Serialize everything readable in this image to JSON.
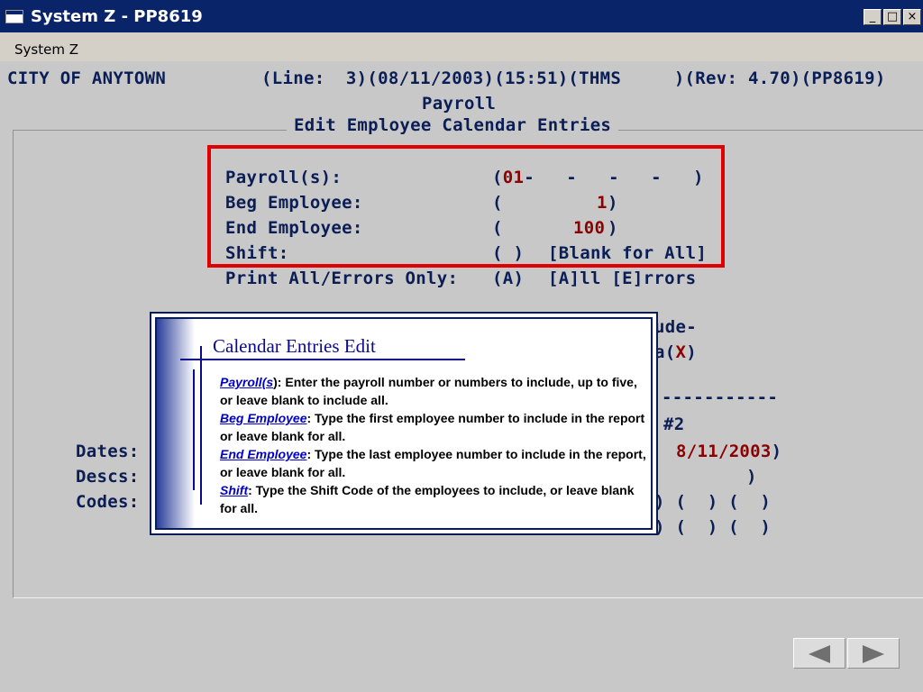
{
  "window": {
    "title": "System Z - PP8619",
    "minimize": "_",
    "maximize": "□",
    "close": "×"
  },
  "menu": {
    "system": "System Z"
  },
  "header": {
    "org": "CITY OF ANYTOWN",
    "status": "(Line:  3)(08/11/2003)(15:51)(THMS     )(Rev: 4.70)(PP8619)",
    "module": "Payroll",
    "section": "Edit Employee Calendar Entries"
  },
  "fields": {
    "payrolls": {
      "label": "Payroll(s):",
      "open": "(",
      "value": "01",
      "rest": "-   -   -   -   )"
    },
    "beg": {
      "label": "Beg Employee:",
      "open": "(",
      "value": "1",
      "close": ")"
    },
    "end": {
      "label": "End Employee:",
      "open": "(",
      "value": "100",
      "close": ")"
    },
    "shift": {
      "label": "Shift:",
      "value": "( )",
      "hint": "[Blank for All]"
    },
    "print": {
      "label": "Print All/Errors Only:",
      "value": "(A)",
      "hint": "[A]ll [E]rrors"
    }
  },
  "background_fragments": {
    "ude": "ude-",
    "a_open": "a(",
    "x": "X",
    "close_paren": ")",
    "dashes": "-----------",
    "num2": "#2",
    "date2": "8/11/2003",
    "desc_close": ")",
    "codes_row1": ") (  ) (  )",
    "codes_row2": ") (  ) (  )",
    "row_left": "(   ) (   ) (   ) (   )"
  },
  "row_labels": {
    "dates": "Dates:",
    "descs": "Descs:",
    "codes": "Codes:"
  },
  "help": {
    "title": "Calendar Entries Edit",
    "items": [
      {
        "term": "Payroll(s",
        "tail": "):  Enter the payroll number or numbers to include, up to five, or leave blank to include all."
      },
      {
        "term": "Beg Employee",
        "tail": ":  Type the first employee number to include in the report or leave blank for all."
      },
      {
        "term": "End Employee",
        "tail": ":  Type the last employee number to include in the report, or leave blank for all."
      },
      {
        "term": "Shift",
        "tail": ":  Type the Shift Code  of the employees to include, or leave blank for all."
      }
    ]
  },
  "nav": {
    "prev_icon": "triangle-left-icon",
    "next_icon": "triangle-right-icon"
  },
  "colors": {
    "titlebar": "#0a246a",
    "text": "#0a1e55",
    "value": "#8b0000",
    "highlight": "#e00000",
    "help_term": "#0000cc"
  }
}
